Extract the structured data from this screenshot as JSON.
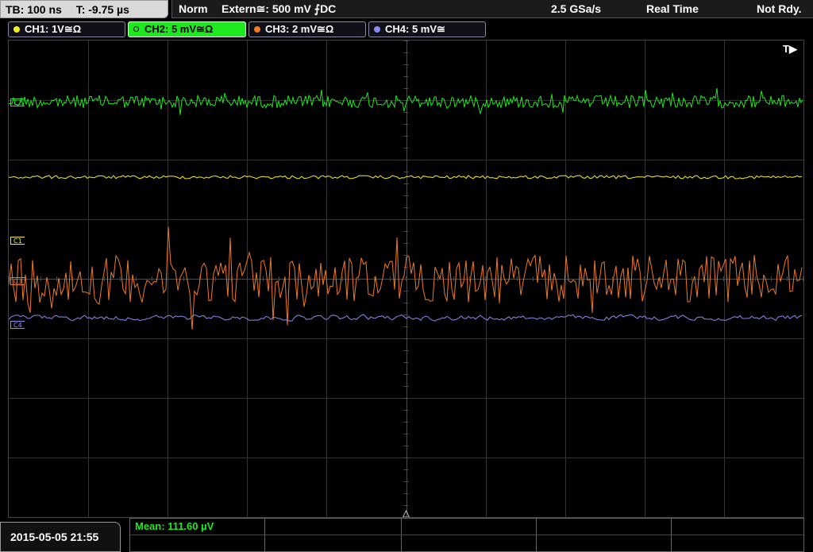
{
  "status": {
    "timebase": "TB: 100 ns",
    "trigger_time": "T: -9.75 µs",
    "mode": "Norm",
    "trigger_source": "Extern≅: 500 mV ⨍DC",
    "sample_rate": "2.5 GSa/s",
    "acq_mode": "Real Time",
    "ready_state": "Not Rdy."
  },
  "channels": [
    {
      "label": "CH1: 1V≅Ω",
      "color": "#f5f01e",
      "active": false
    },
    {
      "label": "CH2: 5 mV≅Ω",
      "color": "#1ee81e",
      "active": true
    },
    {
      "label": "CH3: 2 mV≅Ω",
      "color": "#f07a1e",
      "active": false
    },
    {
      "label": "CH4: 5 mV≅",
      "color": "#8a8af0",
      "active": false
    }
  ],
  "markers": {
    "c1": "C1",
    "c2": "C2",
    "c3": "C3",
    "c4": "C4",
    "trigger_pos": "T▶"
  },
  "measurement": {
    "mean": "Mean: 111.60 µV"
  },
  "datetime": "2015-05-05 21:55",
  "grid": {
    "h_divisions": 10,
    "v_divisions": 8
  }
}
